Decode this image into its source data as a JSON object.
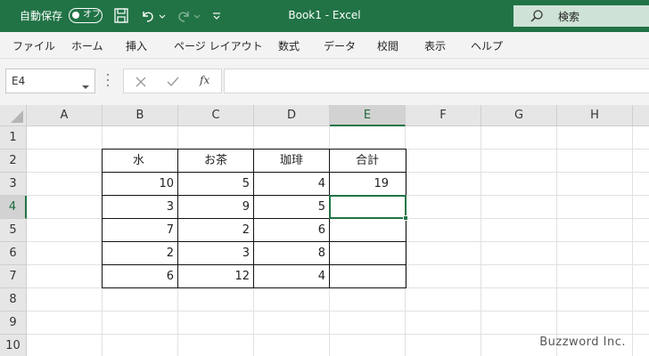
{
  "titlebar": {
    "autosave_label": "自動保存",
    "autosave_state": "オフ",
    "document_title": "Book1  -  Excel",
    "search_label": "検索"
  },
  "ribbon": {
    "tabs": [
      "ファイル",
      "ホーム",
      "挿入",
      "ページ レイアウト",
      "数式",
      "データ",
      "校閲",
      "表示",
      "ヘルプ"
    ]
  },
  "formula_bar": {
    "name_box": "E4",
    "fx_label": "fx",
    "formula": ""
  },
  "sheet": {
    "columns": [
      "A",
      "B",
      "C",
      "D",
      "E",
      "F",
      "G",
      "H"
    ],
    "rows": [
      "1",
      "2",
      "3",
      "4",
      "5",
      "6",
      "7",
      "8",
      "9",
      "10"
    ],
    "selected_column": "E",
    "selected_row": "4",
    "table_header": [
      "水",
      "お茶",
      "珈琲",
      "合計"
    ],
    "table_rows": [
      [
        "10",
        "5",
        "4",
        "19"
      ],
      [
        "3",
        "9",
        "5",
        ""
      ],
      [
        "7",
        "2",
        "6",
        ""
      ],
      [
        "2",
        "3",
        "8",
        ""
      ],
      [
        "6",
        "12",
        "4",
        ""
      ]
    ]
  },
  "watermark": "Buzzword Inc.",
  "colors": {
    "titlebar": "#217346",
    "ribbon": "#f3f3f3",
    "selection": "#217346"
  }
}
